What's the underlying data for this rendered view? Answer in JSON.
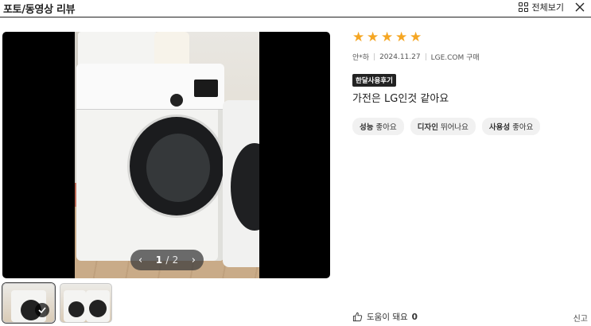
{
  "header": {
    "title": "포토/동영상 리뷰",
    "view_all_label": "전체보기",
    "view_all_icon": "grid-icon",
    "close_icon": "close-icon"
  },
  "viewer": {
    "current_page": "1",
    "separator": "/",
    "total_pages": "2",
    "prev_icon": "chevron-left-icon",
    "next_icon": "chevron-right-icon"
  },
  "thumbnails": [
    {
      "selected": true
    },
    {
      "selected": false
    }
  ],
  "review": {
    "rating": 5,
    "star_color": "#f5a623",
    "author": "안*하",
    "date": "2024.11.27",
    "purchase_source": "LGE.COM 구매",
    "badge": "한달사용후기",
    "content": "가전은 LG인것 같아요",
    "tags": [
      {
        "label": "성능",
        "value": "좋아요"
      },
      {
        "label": "디자인",
        "value": "뛰어나요"
      },
      {
        "label": "사용성",
        "value": "좋아요"
      }
    ],
    "helpful_label": "도움이 돼요",
    "helpful_count": "0",
    "report_label": "신고"
  }
}
